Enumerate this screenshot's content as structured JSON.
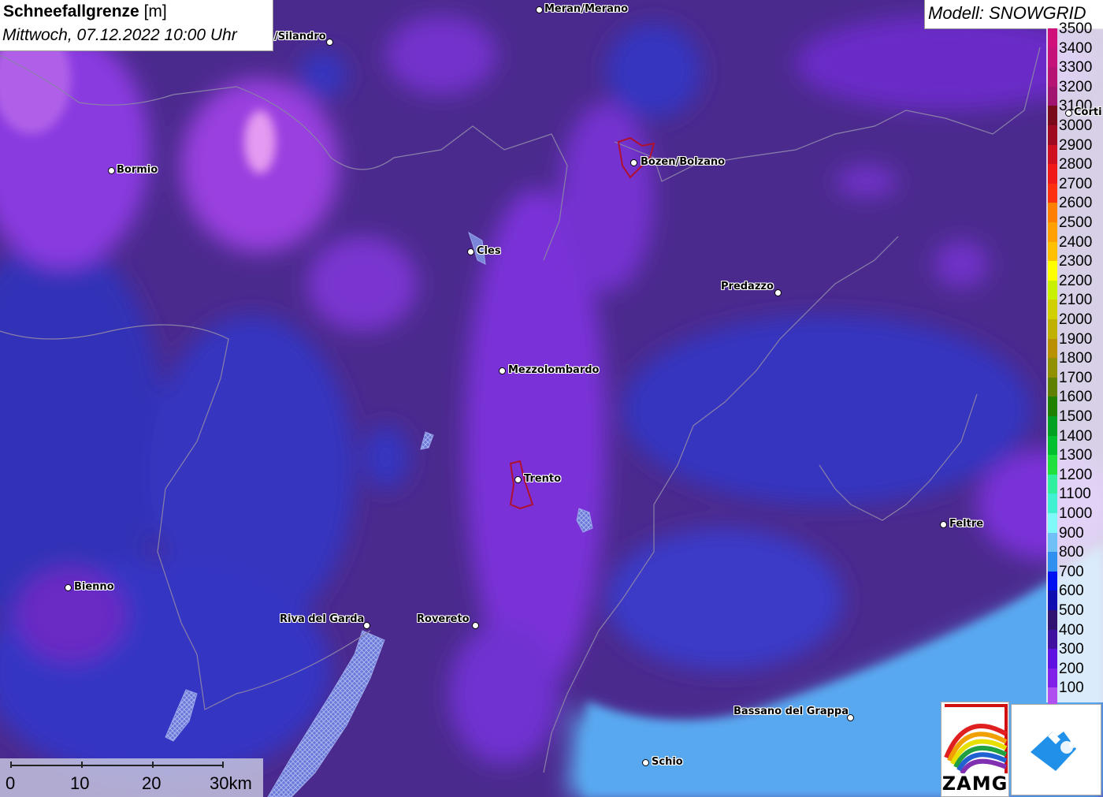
{
  "header": {
    "title": "Schneefallgrenze",
    "unit": "[m]",
    "datetime": "Mittwoch, 07.12.2022 10:00 Uhr"
  },
  "model": {
    "label": "Modell: SNOWGRID"
  },
  "legend": {
    "items": [
      {
        "label": "3500",
        "color": "#d0107a"
      },
      {
        "label": "3400",
        "color": "#c4127a"
      },
      {
        "label": "3300",
        "color": "#b51475"
      },
      {
        "label": "3200",
        "color": "#a01470"
      },
      {
        "label": "3100",
        "color": "#7a0a1a"
      },
      {
        "label": "3000",
        "color": "#a00a20"
      },
      {
        "label": "2900",
        "color": "#d01020"
      },
      {
        "label": "2800",
        "color": "#f01818"
      },
      {
        "label": "2700",
        "color": "#ff3010"
      },
      {
        "label": "2600",
        "color": "#ff8000"
      },
      {
        "label": "2500",
        "color": "#ffa000"
      },
      {
        "label": "2400",
        "color": "#ffc000"
      },
      {
        "label": "2300",
        "color": "#ffff00"
      },
      {
        "label": "2200",
        "color": "#c8f000"
      },
      {
        "label": "2100",
        "color": "#d0d000"
      },
      {
        "label": "2000",
        "color": "#c0b000"
      },
      {
        "label": "1900",
        "color": "#b89000"
      },
      {
        "label": "1800",
        "color": "#909000"
      },
      {
        "label": "1700",
        "color": "#608000"
      },
      {
        "label": "1600",
        "color": "#208000"
      },
      {
        "label": "1500",
        "color": "#00a020"
      },
      {
        "label": "1400",
        "color": "#00c030"
      },
      {
        "label": "1300",
        "color": "#20e040"
      },
      {
        "label": "1200",
        "color": "#30f0a0"
      },
      {
        "label": "1100",
        "color": "#40f0d0"
      },
      {
        "label": "1000",
        "color": "#80f8f8"
      },
      {
        "label": "900",
        "color": "#70c0f8"
      },
      {
        "label": "800",
        "color": "#3090f0"
      },
      {
        "label": "700",
        "color": "#0010f0"
      },
      {
        "label": "600",
        "color": "#1010b0"
      },
      {
        "label": "500",
        "color": "#301070"
      },
      {
        "label": "400",
        "color": "#4010a0"
      },
      {
        "label": "300",
        "color": "#6010e0"
      },
      {
        "label": "200",
        "color": "#8020e8"
      },
      {
        "label": "100",
        "color": "#b050f0"
      }
    ]
  },
  "cities": [
    {
      "name": "Meran/Merano"
    },
    {
      "name": "/Silandro"
    },
    {
      "name": "Bormio"
    },
    {
      "name": "Bozen/Bolzano"
    },
    {
      "name": "Cles"
    },
    {
      "name": "Predazzo"
    },
    {
      "name": "Corti"
    },
    {
      "name": "Mezzolombardo"
    },
    {
      "name": "Trento"
    },
    {
      "name": "Feltre"
    },
    {
      "name": "Bienno"
    },
    {
      "name": "Riva del Garda"
    },
    {
      "name": "Rovereto"
    },
    {
      "name": "Bassano del Grappa"
    },
    {
      "name": "Schio"
    }
  ],
  "scale": {
    "labels": [
      "0",
      "10",
      "20",
      "30km"
    ]
  },
  "logos": {
    "zamg": "ZAMG"
  }
}
